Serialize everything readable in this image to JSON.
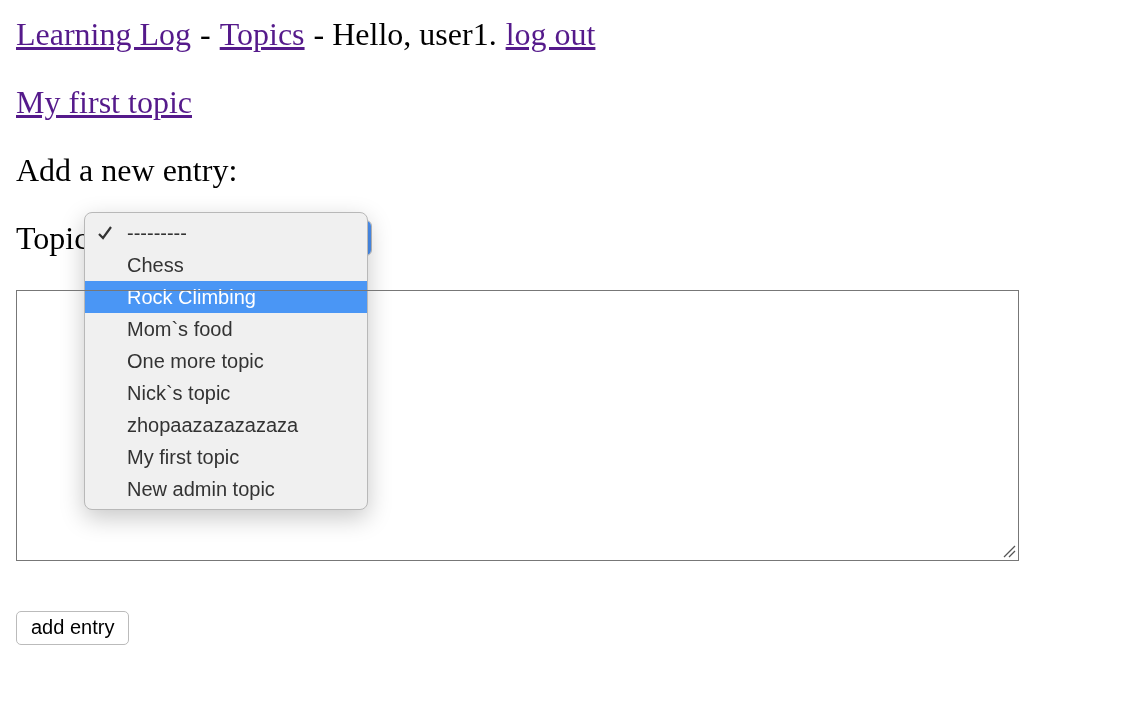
{
  "nav": [
    {
      "kind": "link",
      "text": "Learning Log"
    },
    {
      "kind": "text",
      "text": "-"
    },
    {
      "kind": "link",
      "text": "Topics"
    },
    {
      "kind": "text",
      "text": "- Hello, user1."
    },
    {
      "kind": "link",
      "text": "log out"
    }
  ],
  "topic_link": "My first topic",
  "prompt": "Add a new entry:",
  "form": {
    "topic_label": "Topic",
    "topic_options": [
      {
        "label": "---------",
        "checked": true,
        "selected": false
      },
      {
        "label": "Chess",
        "checked": false,
        "selected": false
      },
      {
        "label": "Rock Climbing",
        "checked": false,
        "selected": true
      },
      {
        "label": "Mom`s food",
        "checked": false,
        "selected": false
      },
      {
        "label": "One more topic",
        "checked": false,
        "selected": false
      },
      {
        "label": "Nick`s topic",
        "checked": false,
        "selected": false
      },
      {
        "label": "zhopaazazazazaza",
        "checked": false,
        "selected": false
      },
      {
        "label": "My first topic",
        "checked": false,
        "selected": false
      },
      {
        "label": "New admin topic",
        "checked": false,
        "selected": false
      }
    ],
    "submit": "add entry"
  }
}
